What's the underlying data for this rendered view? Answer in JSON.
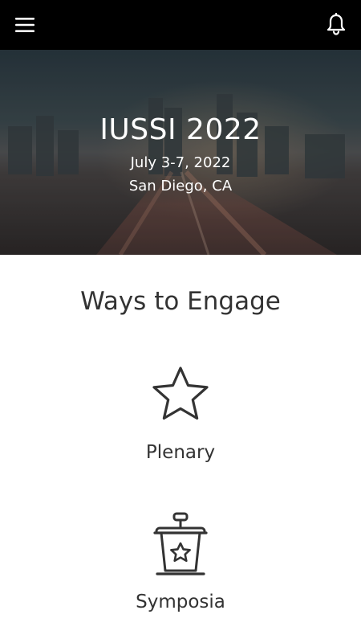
{
  "header": {
    "menu_icon": "hamburger-menu-icon",
    "notification_icon": "bell-icon",
    "background_color": "#000000"
  },
  "hero": {
    "title": "IUSSI 2022",
    "dates": "July 3-7, 2022",
    "location": "San Diego, CA"
  },
  "engage": {
    "title": "Ways to Engage",
    "items": [
      {
        "label": "Plenary",
        "icon": "star-icon"
      },
      {
        "label": "Symposia",
        "icon": "podium-star-icon"
      }
    ]
  },
  "colors": {
    "text_dark": "#333333",
    "hero_text": "#ffffff"
  }
}
